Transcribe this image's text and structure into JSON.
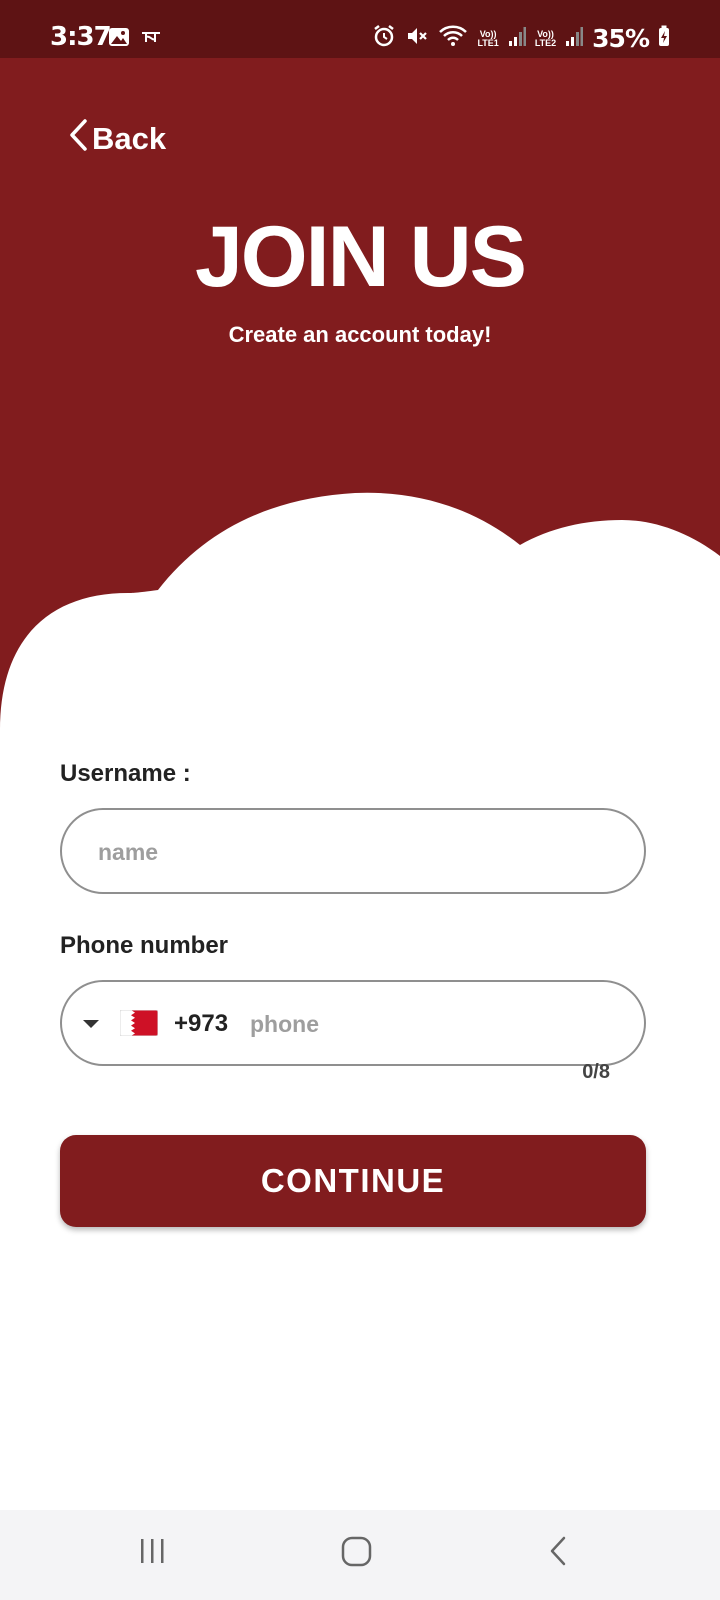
{
  "status_bar": {
    "time": "3:37",
    "lte1": {
      "top": "Vo))",
      "bottom": "LTE1"
    },
    "lte2": {
      "top": "Vo))",
      "bottom": "LTE2"
    },
    "battery": "35%"
  },
  "header": {
    "back_label": "Back",
    "title": "JOIN US",
    "subtitle": "Create an account today!"
  },
  "form": {
    "username_label": "Username :",
    "username_placeholder": "name",
    "phone_label": "Phone number",
    "country_code": "+973",
    "country_flag": "bahrain-flag",
    "phone_placeholder": "phone",
    "phone_counter": "0/8",
    "continue_label": "CONTINUE"
  },
  "colors": {
    "brand": "#811c1e",
    "status_bar": "#5e1314",
    "input_border": "#8f8f8f",
    "placeholder": "#9e9e9e"
  },
  "nav": {
    "icons": [
      "recent-apps-icon",
      "home-icon",
      "back-icon"
    ]
  }
}
